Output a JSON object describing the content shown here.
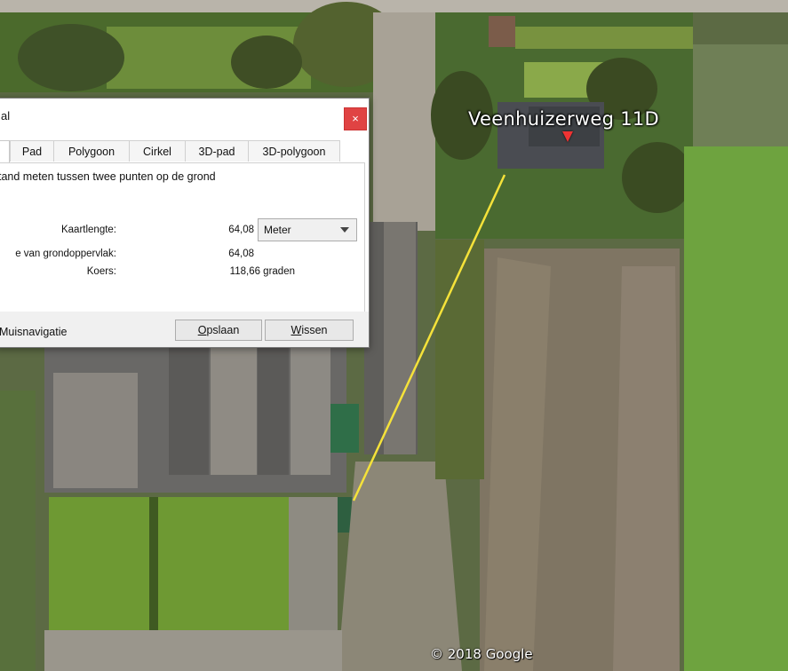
{
  "map": {
    "place_label": "Veenhuizerweg 11D",
    "copyright": "© 2018 Google",
    "line_color": "#f5e23a"
  },
  "dialog": {
    "title": "al",
    "close_label": "×",
    "tabs": [
      {
        "label": ""
      },
      {
        "label": "Pad"
      },
      {
        "label": "Polygoon"
      },
      {
        "label": "Cirkel"
      },
      {
        "label": "3D-pad"
      },
      {
        "label": "3D-polygoon"
      }
    ],
    "description": "tand meten tussen twee punten op de grond",
    "map_length_label": "Kaartlengte:",
    "map_length_value": "64,08",
    "unit_selected": "Meter",
    "ground_length_label": "e van grondoppervlak:",
    "ground_length_value": "64,08",
    "heading_label": "Koers:",
    "heading_value": "118,66 graden",
    "mouse_nav_label": "Muisnavigatie",
    "save_button": {
      "first": "O",
      "rest": "pslaan"
    },
    "clear_button": {
      "first": "W",
      "rest": "issen"
    }
  },
  "colors": {
    "close_button": "#e04343",
    "measure_line": "#f5e23a"
  }
}
